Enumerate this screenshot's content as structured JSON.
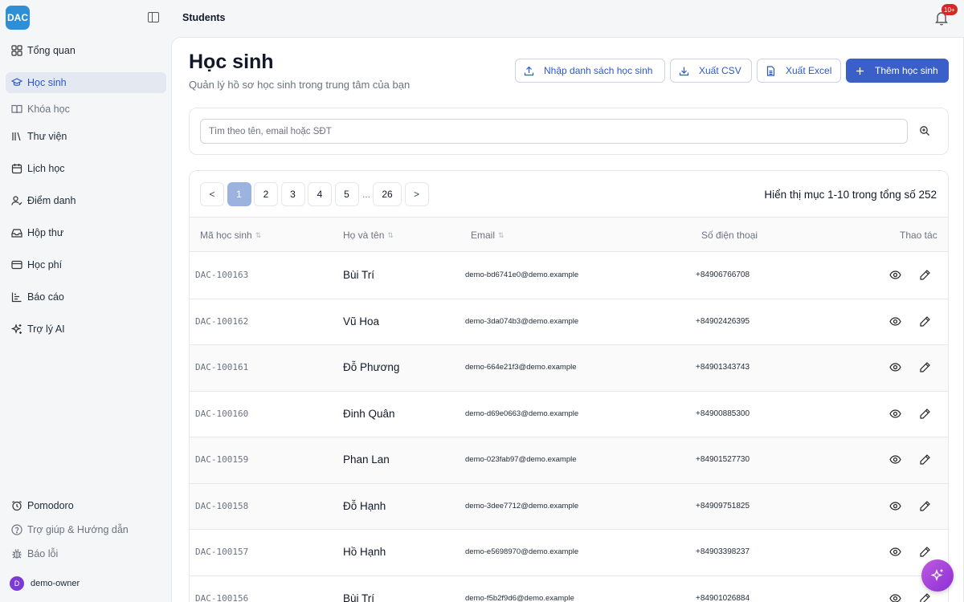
{
  "app": {
    "logo_text": "DAC",
    "header_title": "Students",
    "notification_count": "10+"
  },
  "sidebar": {
    "items": [
      {
        "label": "Tổng quan",
        "icon": "grid-icon"
      },
      {
        "label": "Học sinh",
        "icon": "graduation-cap-icon",
        "active": true
      },
      {
        "label": "Khóa học",
        "icon": "book-icon"
      },
      {
        "label": "Thư viện",
        "icon": "library-icon"
      },
      {
        "label": "Lịch học",
        "icon": "calendar-icon"
      },
      {
        "label": "Điểm danh",
        "icon": "user-check-icon"
      },
      {
        "label": "Hộp thư",
        "icon": "inbox-icon"
      },
      {
        "label": "Học phí",
        "icon": "credit-card-icon"
      },
      {
        "label": "Báo cáo",
        "icon": "bar-chart-icon"
      },
      {
        "label": "Trợ lý AI",
        "icon": "sparkles-icon"
      }
    ],
    "bottom_items": [
      {
        "label": "Pomodoro",
        "icon": "alarm-clock-icon"
      },
      {
        "label": "Trợ giúp & Hướng dẫn",
        "icon": "help-circle-icon"
      },
      {
        "label": "Báo lỗi",
        "icon": "bug-icon"
      }
    ],
    "user": {
      "initial": "D",
      "name": "demo-owner"
    }
  },
  "page": {
    "title": "Học sinh",
    "subtitle": "Quản lý hồ sơ học sinh trong trung tâm của bạn",
    "actions": {
      "import": "Nhập danh sách học sinh",
      "export_csv": "Xuất CSV",
      "export_excel": "Xuất Excel",
      "add": "Thêm học sinh"
    }
  },
  "search": {
    "placeholder": "Tìm theo tên, email hoặc SĐT"
  },
  "pagination": {
    "prev": "<",
    "next": ">",
    "pages": [
      "1",
      "2",
      "3",
      "4",
      "5"
    ],
    "ellipsis": "...",
    "last": "26",
    "current": "1",
    "range_text": "Hiển thị mục 1-10 trong tổng số 252"
  },
  "table": {
    "columns": {
      "id": "Mã học sinh",
      "name": "Họ và tên",
      "email": "Email",
      "phone": "Số điện thoại",
      "actions": "Thao tác"
    },
    "rows": [
      {
        "id": "DAC-100163",
        "name": "Bùi Trí",
        "email": "demo-bd6741e0@demo.example",
        "phone": "+84906766708"
      },
      {
        "id": "DAC-100162",
        "name": "Vũ Hoa",
        "email": "demo-3da074b3@demo.example",
        "phone": "+84902426395"
      },
      {
        "id": "DAC-100161",
        "name": "Đỗ Phương",
        "email": "demo-664e21f3@demo.example",
        "phone": "+84901343743"
      },
      {
        "id": "DAC-100160",
        "name": "Đinh Quân",
        "email": "demo-d69e0663@demo.example",
        "phone": "+84900885300"
      },
      {
        "id": "DAC-100159",
        "name": "Phan Lan",
        "email": "demo-023fab97@demo.example",
        "phone": "+84901527730"
      },
      {
        "id": "DAC-100158",
        "name": "Đỗ Hạnh",
        "email": "demo-3dee7712@demo.example",
        "phone": "+84909751825"
      },
      {
        "id": "DAC-100157",
        "name": "Hồ Hạnh",
        "email": "demo-e5698970@demo.example",
        "phone": "+84903398237"
      },
      {
        "id": "DAC-100156",
        "name": "Bùi Trí",
        "email": "demo-f5b2f9d6@demo.example",
        "phone": "+84901026884"
      }
    ]
  }
}
